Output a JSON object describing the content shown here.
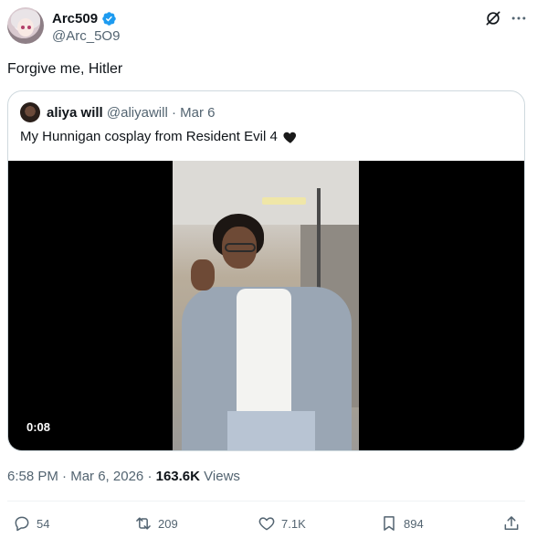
{
  "author": {
    "display_name": "Arc509",
    "handle": "@Arc_5O9",
    "verified": true
  },
  "tweet": {
    "text": "Forgive me, Hitler"
  },
  "quoted": {
    "display_name": "aliya will",
    "handle": "@aliyawill",
    "separator": "·",
    "date": "Mar 6",
    "text": "My Hunnigan cosplay from Resident Evil 4",
    "video_duration": "0:08"
  },
  "meta": {
    "time": "6:58 PM",
    "separator": "·",
    "date": "Mar 6, 2026",
    "separator2": "·",
    "views_count": "163.6K",
    "views_label": "Views"
  },
  "actions": {
    "replies": "54",
    "reposts": "209",
    "likes": "7.1K",
    "bookmarks": "894"
  },
  "icons": {
    "verified": "verified-badge-icon",
    "grok": "grok-icon",
    "more": "more-icon",
    "reply": "reply-icon",
    "repost": "repost-icon",
    "like": "like-icon",
    "bookmark": "bookmark-icon",
    "share": "share-icon"
  },
  "colors": {
    "accent": "#1d9bf0",
    "text_secondary": "#536471",
    "border": "#cfd9de"
  }
}
